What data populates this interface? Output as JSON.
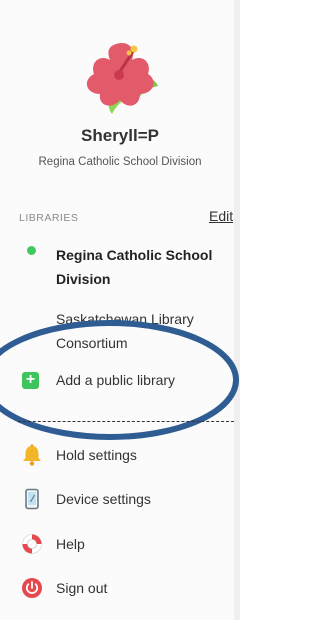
{
  "profile": {
    "name": "Sheryll=P",
    "organization": "Regina Catholic School Division",
    "avatar_icon": "hibiscus-flower-icon"
  },
  "libraries": {
    "section_label": "LIBRARIES",
    "edit_label": "Edit",
    "items": [
      {
        "label": "Regina Catholic School Division",
        "active": true
      },
      {
        "label": "Saskatchewan Library Consortium",
        "active": false
      }
    ],
    "add_label": "Add a public library"
  },
  "menu": {
    "items": [
      {
        "label": "Hold settings",
        "icon": "bell-icon"
      },
      {
        "label": "Device settings",
        "icon": "device-icon"
      },
      {
        "label": "Help",
        "icon": "lifebuoy-icon"
      },
      {
        "label": "Sign out",
        "icon": "power-icon"
      }
    ]
  },
  "colors": {
    "active_dot": "#41c95f",
    "add_icon": "#3ec45c",
    "annotation_ellipse": "#2f5d93",
    "flower": "#e35a6a",
    "sign_out": "#e5484d"
  }
}
